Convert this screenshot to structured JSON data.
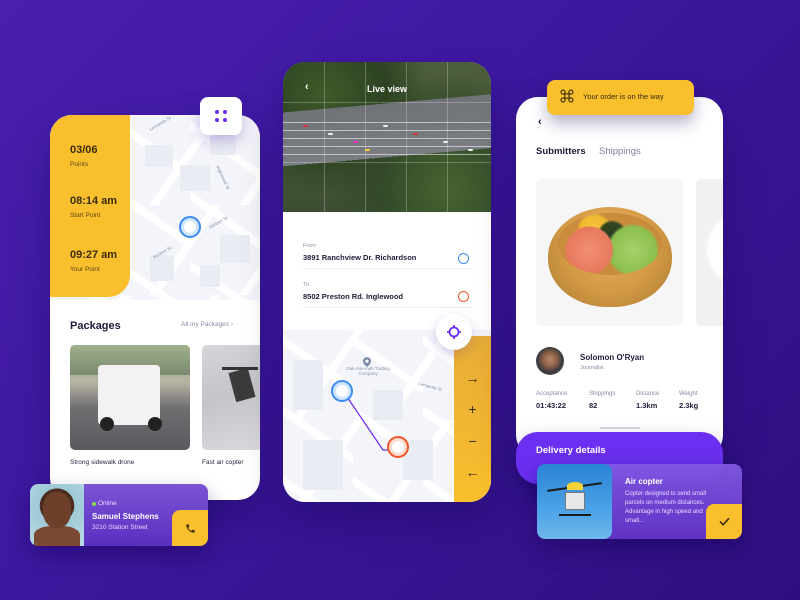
{
  "colors": {
    "background": "#3d18a0",
    "accent_purple": "#6a2ff0",
    "accent_yellow": "#f9bf2c",
    "pin_blue": "#3d8cf0",
    "pin_red": "#f0552c"
  },
  "tracking_screen": {
    "menu_icon": "grid-dots-icon",
    "stats": [
      {
        "value": "03/06",
        "label": "Points"
      },
      {
        "value": "08:14 am",
        "label": "Start Point"
      },
      {
        "value": "09:27 am",
        "label": "Your Point"
      }
    ],
    "map_streets": [
      "Lemanda St",
      "Inglewood St",
      "Herbert St",
      "Herbert St"
    ],
    "packages": {
      "title": "Packages",
      "all_link": "All my Packages",
      "items": [
        {
          "caption": "Strong sidewalk drone"
        },
        {
          "caption": "Fast air copter"
        }
      ]
    },
    "contact": {
      "status": "Online",
      "name": "Samuel Stephens",
      "address": "3210  Station Street",
      "call_icon": "phone-icon"
    }
  },
  "live_view_screen": {
    "title": "Live view",
    "back_icon": "chevron-left-icon",
    "from_label": "From",
    "from_value": "3891 Ranchview Dr. Richardson",
    "to_label": "To",
    "to_value": "8502 Preston Rd. Inglewood",
    "map_poi": "Oak-ma-i-nah Trading Company",
    "map_street": "Lemanda St",
    "controls": [
      {
        "icon": "arrow-right-icon",
        "glyph": "→"
      },
      {
        "icon": "zoom-in-icon",
        "glyph": "+"
      },
      {
        "icon": "zoom-out-icon",
        "glyph": "−"
      },
      {
        "icon": "arrow-left-icon",
        "glyph": "←"
      }
    ]
  },
  "order_screen": {
    "notification": "Your order is on the way",
    "tabs": [
      {
        "label": "Submitters",
        "active": true
      },
      {
        "label": "Shippings",
        "active": false
      }
    ],
    "submitter": {
      "name": "Solomon O'Ryan",
      "role": "Journalist"
    },
    "metrics": [
      {
        "label": "Acceptance",
        "value": "01:43:22"
      },
      {
        "label": "Shippings",
        "value": "82"
      },
      {
        "label": "Distance",
        "value": "1.3km"
      },
      {
        "label": "Weight",
        "value": "2.3kg"
      }
    ],
    "delivery": {
      "title": "Delivery details",
      "item_title": "Air copter",
      "item_desc": "Copter designed to send small parcels on medium distances. Advantage in high speed and small...",
      "confirm_icon": "check-icon"
    }
  }
}
